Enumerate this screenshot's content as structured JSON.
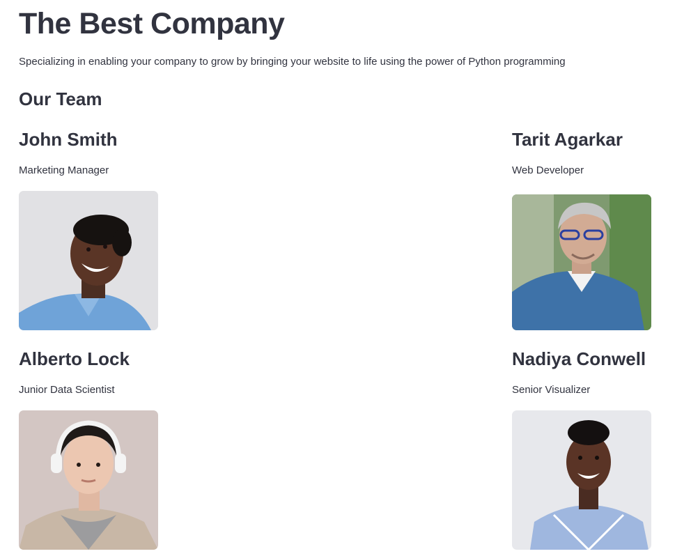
{
  "header": {
    "title": "The Best Company",
    "tagline": "Specializing in enabling your company to grow by bringing your website to life using the power of Python programming"
  },
  "team": {
    "heading": "Our Team",
    "members": [
      {
        "name": "John Smith",
        "role": "Marketing Manager",
        "photo": "portrait-photo"
      },
      {
        "name": "Tarit Agarkar",
        "role": "Web Developer",
        "photo": "portrait-photo"
      },
      {
        "name": "Alberto Lock",
        "role": "Junior Data Scientist",
        "photo": "portrait-photo"
      },
      {
        "name": "Nadiya Conwell",
        "role": "Senior Visualizer",
        "photo": "portrait-photo"
      }
    ]
  },
  "colors": {
    "text": "#31333f",
    "background": "#ffffff"
  }
}
